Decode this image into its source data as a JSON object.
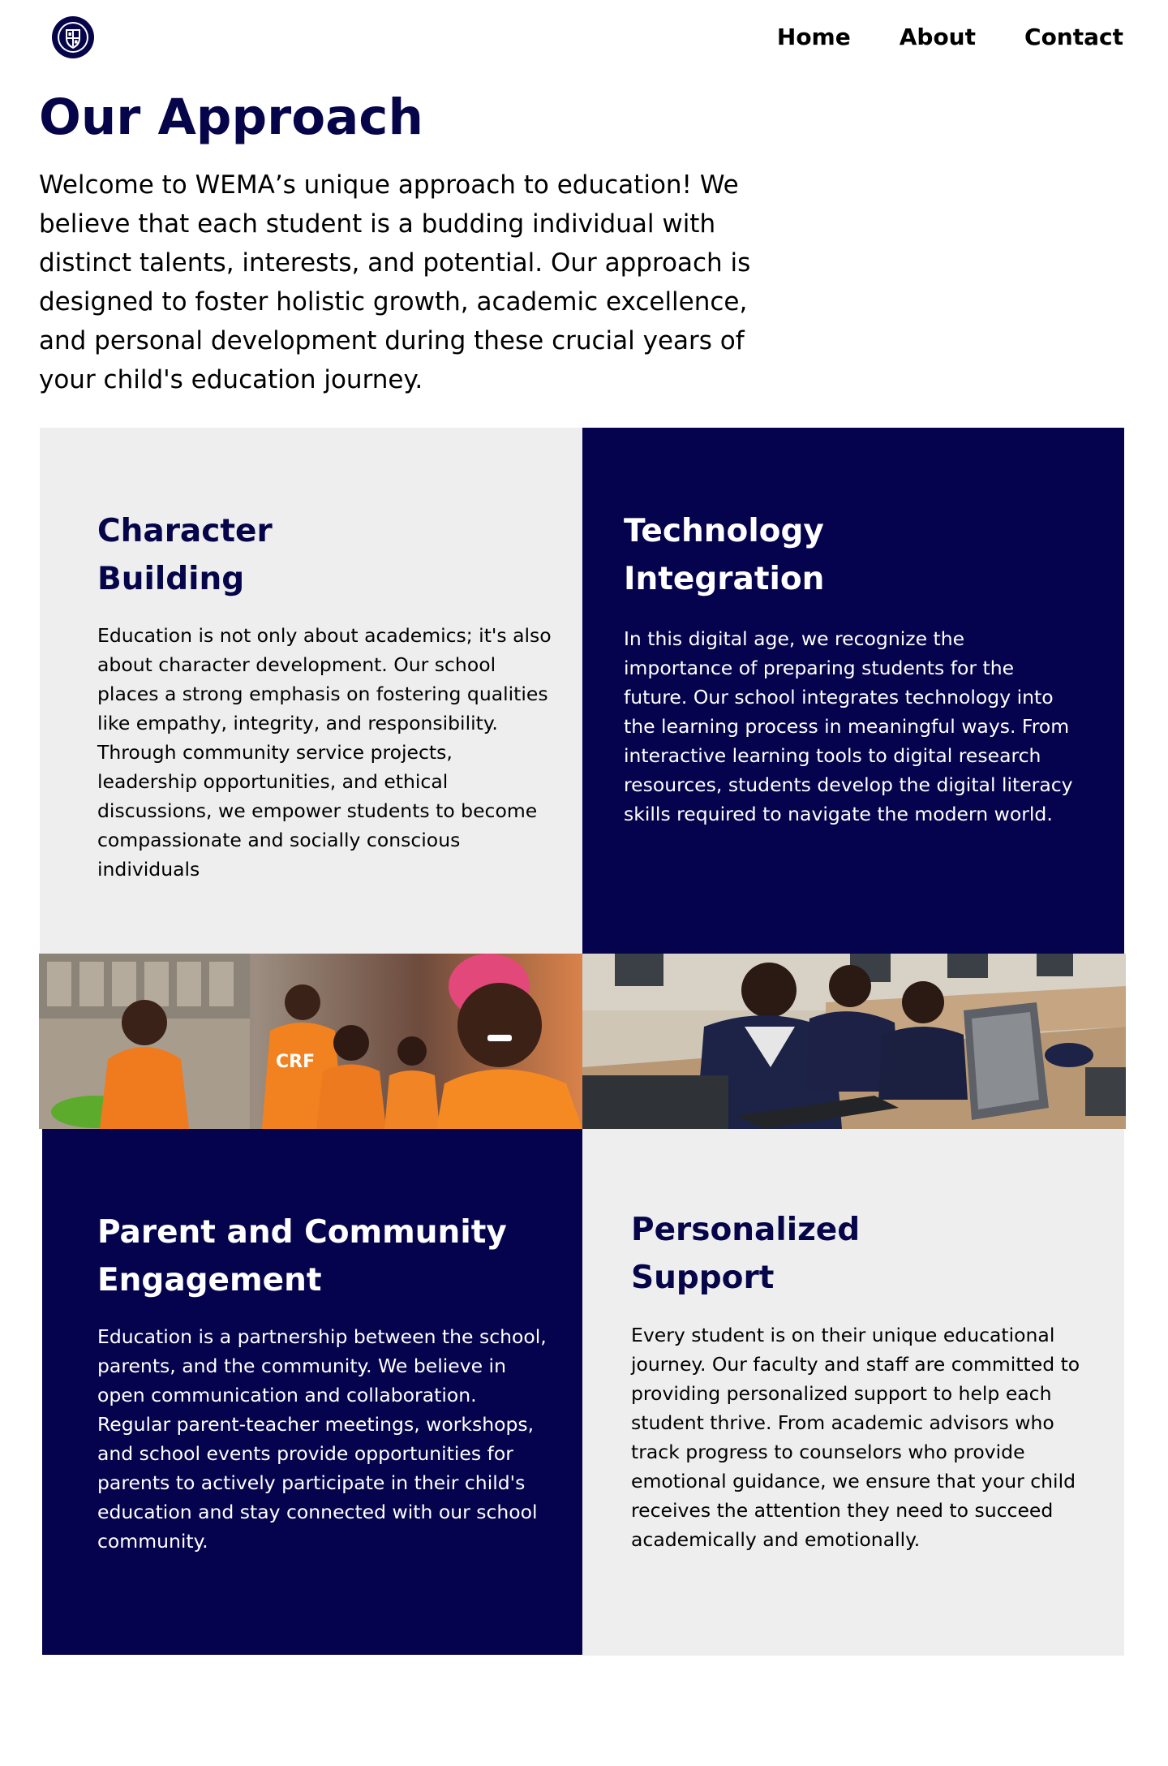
{
  "nav": {
    "items": [
      {
        "label": "Home"
      },
      {
        "label": "About"
      },
      {
        "label": "Contact"
      }
    ]
  },
  "logo": {
    "icon": "school-crest-icon",
    "color": "#07054a"
  },
  "hero": {
    "title": "Our Approach",
    "intro": "Welcome to WEMA’s unique approach to education! We believe that each student is a budding individual with distinct talents, interests, and potential. Our approach is designed to foster holistic growth, academic excellence, and personal development during these crucial years of your child's education journey."
  },
  "sections": {
    "character": {
      "title_line1": "Character",
      "title_line2": "Building",
      "text": "Education is not only about academics; it's also about character development. Our school places a strong emphasis on fostering qualities like empathy, integrity, and responsibility. Through community service projects, leadership opportunities, and ethical discussions, we empower students to become compassionate and socially conscious individuals"
    },
    "technology": {
      "title_line1": "Technology",
      "title_line2": "Integration",
      "text": "In this digital age, we recognize the importance of preparing students for the future. Our school integrates technology into the learning process in meaningful ways. From interactive learning tools to digital research resources, students develop the digital literacy skills required to navigate the modern world."
    },
    "community": {
      "title_line1": "Parent and Community",
      "title_line2": "Engagement",
      "text": "Education is a partnership between the school, parents, and the community. We believe in open communication and collaboration. Regular parent-teacher meetings, workshops, and school events provide opportunities for parents to actively participate in their child's education and stay connected with our school community."
    },
    "support": {
      "title_line1": "Personalized",
      "title_line2": "Support",
      "text": "Every student is on their unique educational journey. Our faculty and staff are committed to providing personalized support to help each student thrive. From academic advisors who track progress to counselors who provide emotional guidance, we ensure that your child receives the attention they need to succeed academically and emotionally."
    }
  },
  "photos": {
    "left": {
      "label": "CRF"
    },
    "right": {
      "label": ""
    }
  },
  "colors": {
    "brand_navy": "#05034d",
    "title_navy": "#07054a",
    "panel_light": "#eeeeee",
    "text_dark": "#000000",
    "text_light": "#ffffff"
  }
}
